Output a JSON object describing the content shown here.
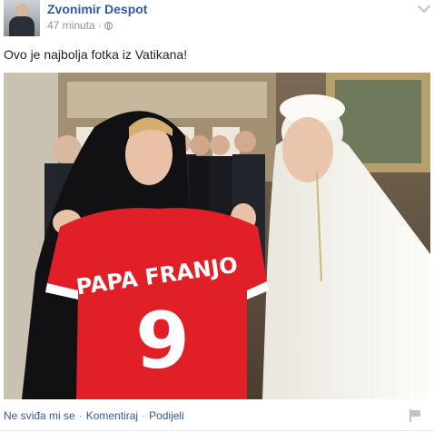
{
  "post": {
    "author": "Zvonimir Despot",
    "time": "47 minuta",
    "separator": "·",
    "text": "Ovo je najbolja fotka iz Vatikana!",
    "photo": {
      "jersey_name": "PAPA FRANJO",
      "jersey_number": "9"
    },
    "actions": {
      "like": "Ne sviđa mi se",
      "comment": "Komentiraj",
      "share": "Podijeli",
      "dot": "·"
    }
  },
  "icons": {
    "privacy": "globe-icon",
    "options": "chevron-down-icon",
    "report": "flag-icon"
  },
  "colors": {
    "link": "#365899",
    "meta": "#90949c",
    "jersey": "#e01f26"
  }
}
